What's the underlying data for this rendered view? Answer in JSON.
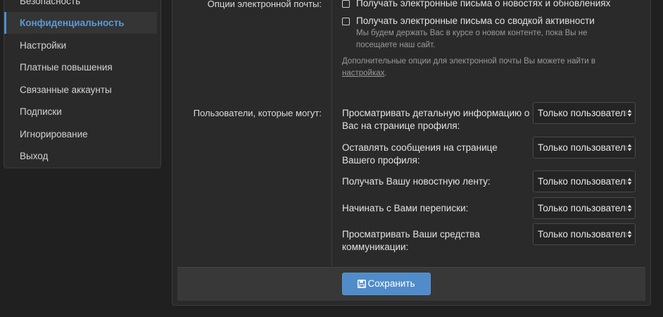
{
  "sidebar": {
    "items": [
      {
        "label": "Безопасность"
      },
      {
        "label": "Конфиденциальность",
        "active": true
      },
      {
        "label": "Настройки"
      },
      {
        "label": "Платные повышения"
      },
      {
        "label": "Связанные аккаунты"
      },
      {
        "label": "Подписки"
      },
      {
        "label": "Игнорирование"
      },
      {
        "label": "Выход"
      }
    ]
  },
  "email_options": {
    "label": "Опции электронной почты:",
    "checkbox_news": "Получать электронные письма о новостях и обновлениях",
    "checkbox_digest": "Получать электронные письма со сводкой активности",
    "digest_hint_line1": "Мы будем держать Вас в курсе о новом контенте, пока Вы не",
    "digest_hint_line2": "посещаете наш сайт.",
    "extra_hint_line1": "Дополнительные опции для электронной почты Вы можете найти в",
    "extra_hint_link": "настройках",
    "extra_hint_end": "."
  },
  "permissions": {
    "label": "Пользователи, которые могут:",
    "rows": [
      {
        "line1": "Просматривать детальную информацию о",
        "line2": "Вас на странице профиля:",
        "value": "Только пользователи"
      },
      {
        "line1": "Оставлять сообщения на странице",
        "line2": "Вашего профиля:",
        "value": "Только пользователи"
      },
      {
        "line1": "Получать Вашу новостную ленту:",
        "line2": "",
        "value": "Только пользователи"
      },
      {
        "line1": "Начинать с Вами переписки:",
        "line2": "",
        "value": "Только пользователи"
      },
      {
        "line1": "Просматривать Ваши средства",
        "line2": "коммуникации:",
        "value": "Только пользователи"
      }
    ]
  },
  "footer": {
    "save_label": "Сохранить",
    "save_icon": "save-icon"
  },
  "colors": {
    "accent": "#4f8cc9",
    "active_nav": "#5b9ad6"
  }
}
